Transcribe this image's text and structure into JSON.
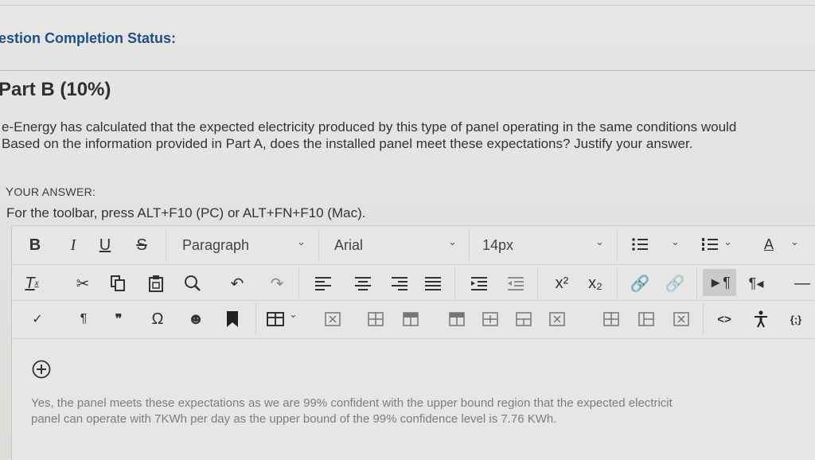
{
  "header": {
    "status_label": "estion Completion Status:"
  },
  "part": {
    "title": "Part B (10%)"
  },
  "question": {
    "line1": "e-Energy has calculated that the expected electricity produced by this type of panel operating in the same conditions would",
    "line2": "Based on the information provided in Part A, does the installed panel meet these expectations? Justify your answer."
  },
  "answer_section": {
    "label_Y": "Y",
    "label_rest": "OUR ANSWER:",
    "toolbar_hint": "For the toolbar, press ALT+F10 (PC) or ALT+FN+F10 (Mac)."
  },
  "toolbar": {
    "bold": "B",
    "italic": "I",
    "underline": "U",
    "strikethrough": "S",
    "format_select": "Paragraph",
    "font_select": "Arial",
    "size_select": "14px",
    "font_color": "A",
    "superscript": "x²",
    "subscript": "x₂",
    "pilcrow": "¶",
    "quote": "❞",
    "omega": "Ω",
    "code": "<>",
    "braces": "{;}",
    "minus": "—"
  },
  "answer": {
    "line1": "Yes, the panel meets these expectations as we are 99% confident with the upper bound region that the expected electricit",
    "line2": "panel can operate with 7KWh per day as the upper bound of the 99% confidence level is 7.76 KWh."
  },
  "colors": {
    "status": "#1e4e8c",
    "answer_text": "#7a7d84",
    "active_button": "#c9cacc"
  },
  "icons": [
    "scissors-icon",
    "copy-icon",
    "paste-icon",
    "search-icon",
    "undo-icon",
    "redo-icon",
    "align-left-icon",
    "align-center-icon",
    "align-right-icon",
    "justify-icon",
    "indent-icon",
    "outdent-icon",
    "link-icon",
    "unlink-icon",
    "ltr-icon",
    "rtl-icon",
    "checkmark-icon",
    "emoji-icon",
    "bookmark-icon",
    "table-icon",
    "plus-circle-icon",
    "accessibility-icon"
  ]
}
